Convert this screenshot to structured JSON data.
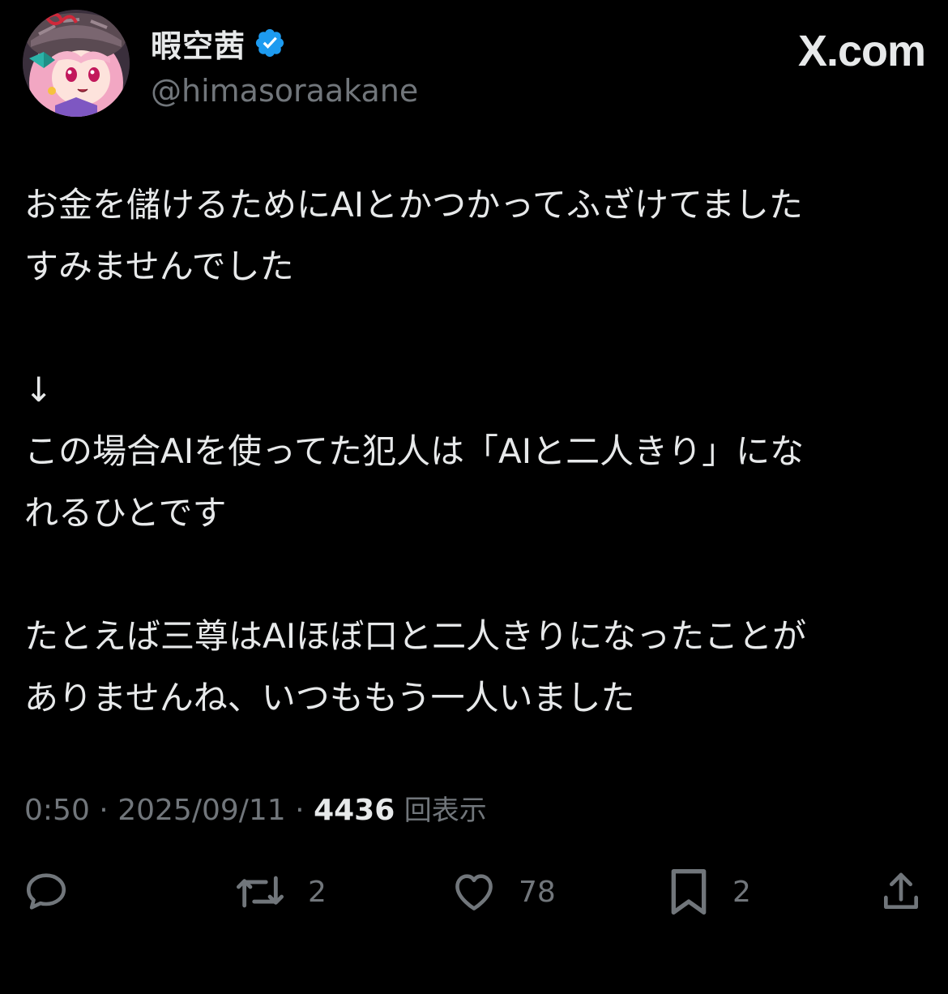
{
  "user": {
    "display_name": "暇空茜",
    "handle": "@himasoraakane",
    "verified": true
  },
  "brand": "X.com",
  "tweet": {
    "lines": [
      "お金を儲けるためにAIとかつかってふざけてました",
      "すみませんでした",
      "",
      "↓",
      "この場合AIを使ってた犯人は「AIと二人きり」にな",
      "れるひとです",
      "",
      "たとえば三尊はAIほぼ口と二人きりになったことが",
      "ありませんね、いつももう一人いました"
    ]
  },
  "meta": {
    "time": "0:50",
    "separator": "·",
    "date": "2025/09/11",
    "views": "4436",
    "views_label": "回表示"
  },
  "actions": {
    "reply": {
      "icon": "reply-icon",
      "count": ""
    },
    "retweet": {
      "icon": "retweet-icon",
      "count": "2"
    },
    "like": {
      "icon": "heart-icon",
      "count": "78"
    },
    "bookmark": {
      "icon": "bookmark-icon",
      "count": "2"
    },
    "share": {
      "icon": "share-icon",
      "count": ""
    }
  },
  "colors": {
    "background": "#000000",
    "text": "#e7e9ea",
    "muted": "#71767b",
    "verified": "#1d9bf0"
  }
}
